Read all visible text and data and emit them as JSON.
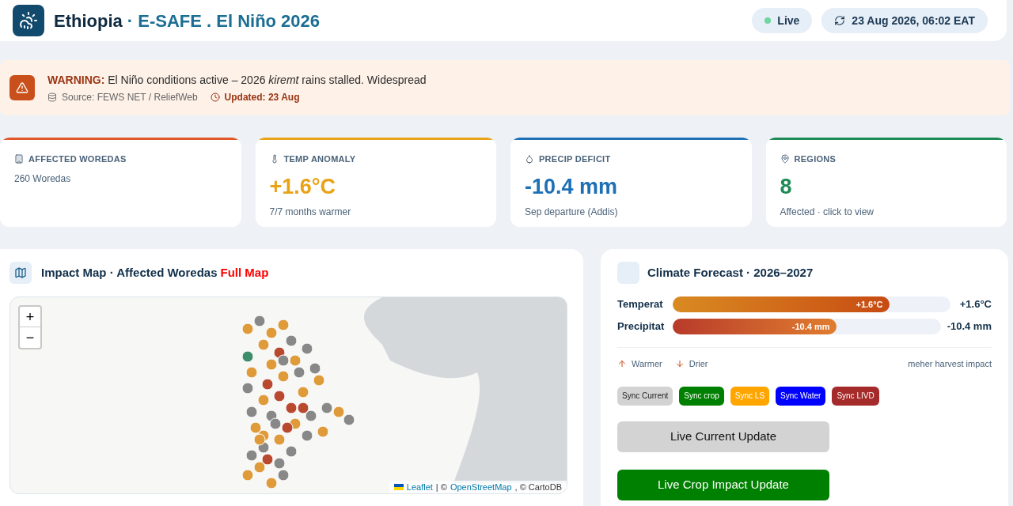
{
  "header": {
    "title": "Ethiopia",
    "subtitle": "· E-SAFE . El Niño 2026",
    "live": {
      "label": "Live",
      "on": true
    },
    "timestamp": "23 Aug 2026, 06:02 EAT"
  },
  "warning": {
    "text": "**WARNING:** El Niño conditions active – 2026 *kiremt* rains stalled. Widespread",
    "source": "Source: FEWS NET / ReliefWeb",
    "updated": "Updated: 23 Aug"
  },
  "stats": [
    {
      "kind": "building",
      "label": "AFFECTED WOREDAS",
      "sub": "260 Woredas",
      "color": "#e0582a"
    },
    {
      "kind": "thermometer",
      "label": "TEMP ANOMALY",
      "value": "+1.6°C",
      "sub": "7/7 months warmer",
      "color": "#e8a317"
    },
    {
      "kind": "drop",
      "label": "PRECIP DEFICIT",
      "value": "-10.4 mm",
      "sub": "Sep departure (Addis)",
      "color": "#1f6fb5"
    },
    {
      "kind": "pin",
      "label": "REGIONS",
      "value": "8",
      "sub": "Affected · click to view",
      "color": "#1e8a55"
    }
  ],
  "map_panel": {
    "title": "Impact Map · Affected Woredas",
    "link": "Full Map",
    "zoom_in": "+",
    "zoom_out": "−",
    "attribution": {
      "leaflet": "Leaflet",
      "separator": "| ©",
      "osm": "OpenStreetMap",
      "rest": ", © CartoDB"
    }
  },
  "forecast": {
    "title": "Climate Forecast · 2026–2027",
    "bars": [
      {
        "kind": "warm",
        "label": "Temperat",
        "level": 0.78,
        "bar_text": "+1.6°C",
        "reading": "+1.6°C"
      },
      {
        "kind": "dry",
        "label": "Precipitat",
        "level": 0.61,
        "bar_text": "-10.4 mm",
        "reading": "-10.4 mm"
      }
    ],
    "legend": [
      {
        "kind": "up",
        "label": "Warmer"
      },
      {
        "kind": "down",
        "label": "Drier"
      }
    ],
    "note": "meher harvest impact",
    "sync_buttons": [
      {
        "label": "Sync Current",
        "color": "#d3d3d3"
      },
      {
        "label": "Sync crop",
        "color": "#008000"
      },
      {
        "label": "Sync LS",
        "color": "#ffa500"
      },
      {
        "label": "Sync Water",
        "color": "#0000ff"
      },
      {
        "label": "Sync LIVD",
        "color": "#a52a2a"
      }
    ],
    "actions": [
      {
        "kind": "current",
        "label": "Live Current Update"
      },
      {
        "kind": "crop",
        "label": "Live Crop Impact Update"
      }
    ]
  }
}
